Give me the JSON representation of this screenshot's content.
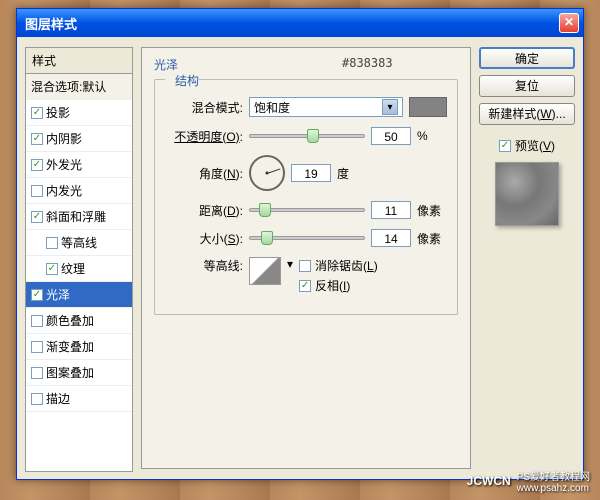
{
  "dialog": {
    "title": "图层样式"
  },
  "leftPanel": {
    "header": "样式",
    "defaultRow": "混合选项:默认",
    "items": [
      {
        "label": "投影",
        "checked": true,
        "indent": 0
      },
      {
        "label": "内阴影",
        "checked": true,
        "indent": 0
      },
      {
        "label": "外发光",
        "checked": true,
        "indent": 0
      },
      {
        "label": "内发光",
        "checked": false,
        "indent": 0
      },
      {
        "label": "斜面和浮雕",
        "checked": true,
        "indent": 0
      },
      {
        "label": "等高线",
        "checked": false,
        "indent": 1
      },
      {
        "label": "纹理",
        "checked": true,
        "indent": 1
      },
      {
        "label": "光泽",
        "checked": true,
        "indent": 0,
        "selected": true
      },
      {
        "label": "颜色叠加",
        "checked": false,
        "indent": 0
      },
      {
        "label": "渐变叠加",
        "checked": false,
        "indent": 0
      },
      {
        "label": "图案叠加",
        "checked": false,
        "indent": 0
      },
      {
        "label": "描边",
        "checked": false,
        "indent": 0
      }
    ]
  },
  "center": {
    "title": "光泽",
    "hex": "#838383",
    "structureLabel": "结构",
    "blendMode": {
      "label": "混合模式:",
      "value": "饱和度"
    },
    "opacity": {
      "label": "不透明度(O):",
      "value": "50",
      "unit": "%",
      "pos": 50
    },
    "angle": {
      "label": "角度(N):",
      "value": "19",
      "unit": "度"
    },
    "distance": {
      "label": "距离(D):",
      "value": "11",
      "unit": "像素",
      "pos": 8
    },
    "size": {
      "label": "大小(S):",
      "value": "14",
      "unit": "像素",
      "pos": 10
    },
    "contour": {
      "label": "等高线:",
      "antialias": "消除锯齿(L)",
      "antialiasChecked": false,
      "invert": "反相(I)",
      "invertChecked": true
    }
  },
  "right": {
    "ok": "确定",
    "cancel": "复位",
    "newStyle": "新建样式(W)...",
    "preview": "预览(V)",
    "previewChecked": true
  },
  "watermark": {
    "brand": "JCWCN",
    "sub1": "PS爱好者教程网",
    "sub2": "www.psahz.com"
  }
}
